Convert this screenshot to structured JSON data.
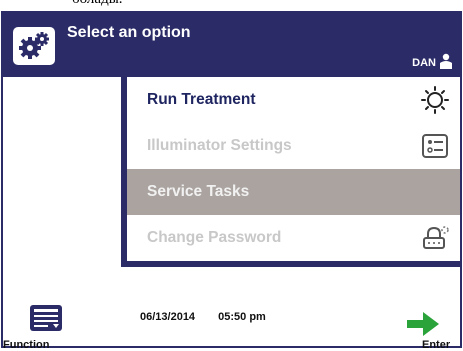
{
  "caption": "болады.",
  "header": {
    "title": "Select an option",
    "user_name": "DAN",
    "icon": "gears-icon",
    "user_icon": "person-icon"
  },
  "menu": {
    "items": [
      {
        "label": "Run Treatment",
        "state": "active",
        "icon": "sun-icon"
      },
      {
        "label": "Illuminator Settings",
        "state": "disabled",
        "icon": "settings-list-icon"
      },
      {
        "label": "Service Tasks",
        "state": "selected",
        "icon": ""
      },
      {
        "label": "Change Password",
        "state": "disabled",
        "icon": "lock-keypad-icon"
      }
    ]
  },
  "footer": {
    "function_label": "Function",
    "function_icon": "device-card-icon",
    "date": "06/13/2014",
    "time": "05:50 pm",
    "enter_label": "Enter",
    "enter_icon": "right-arrow-icon"
  },
  "colors": {
    "navy": "#2b2b68",
    "selected_bg": "#aaa3a0",
    "active_text": "#1f2560",
    "disabled_text": "#c8c8c8",
    "arrow_green": "#2aa33a"
  }
}
